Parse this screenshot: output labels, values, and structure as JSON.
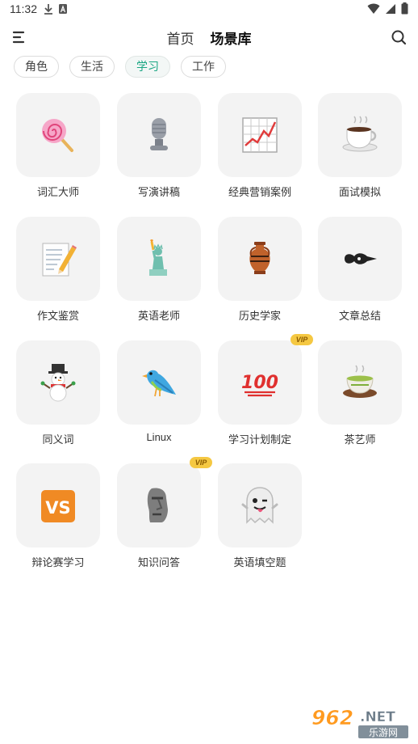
{
  "status_bar": {
    "time": "11:32"
  },
  "header": {
    "tabs": [
      {
        "label": "首页",
        "active": false
      },
      {
        "label": "场景库",
        "active": true
      }
    ]
  },
  "chips": [
    {
      "label": "角色",
      "active": false
    },
    {
      "label": "生活",
      "active": false
    },
    {
      "label": "学习",
      "active": true
    },
    {
      "label": "工作",
      "active": false
    }
  ],
  "cards": [
    {
      "label": "词汇大师",
      "icon": "lollipop-icon",
      "vip": false
    },
    {
      "label": "写演讲稿",
      "icon": "microphone-icon",
      "vip": false
    },
    {
      "label": "经典营销案例",
      "icon": "chart-icon",
      "vip": false
    },
    {
      "label": "面试模拟",
      "icon": "coffee-cup-icon",
      "vip": false
    },
    {
      "label": "作文鉴赏",
      "icon": "memo-pencil-icon",
      "vip": false
    },
    {
      "label": "英语老师",
      "icon": "statue-of-liberty-icon",
      "vip": false
    },
    {
      "label": "历史学家",
      "icon": "amphora-icon",
      "vip": false
    },
    {
      "label": "文章总结",
      "icon": "fountain-pen-nib-icon",
      "vip": false
    },
    {
      "label": "同义词",
      "icon": "snowman-icon",
      "vip": false
    },
    {
      "label": "Linux",
      "icon": "bird-icon",
      "vip": false
    },
    {
      "label": "学习计划制定",
      "icon": "hundred-points-icon",
      "vip": true
    },
    {
      "label": "茶艺师",
      "icon": "green-tea-icon",
      "vip": false
    },
    {
      "label": "辩论赛学习",
      "icon": "vs-button-icon",
      "vip": false
    },
    {
      "label": "知识问答",
      "icon": "moai-icon",
      "vip": true
    },
    {
      "label": "英语填空题",
      "icon": "ghost-icon",
      "vip": false
    }
  ],
  "vip_label": "VIP",
  "watermark": {
    "brand": "962.NET",
    "caption": "乐游网"
  },
  "colors": {
    "accent": "#1aa683",
    "tile_bg": "#f3f3f3",
    "vip": "#f5c842"
  }
}
